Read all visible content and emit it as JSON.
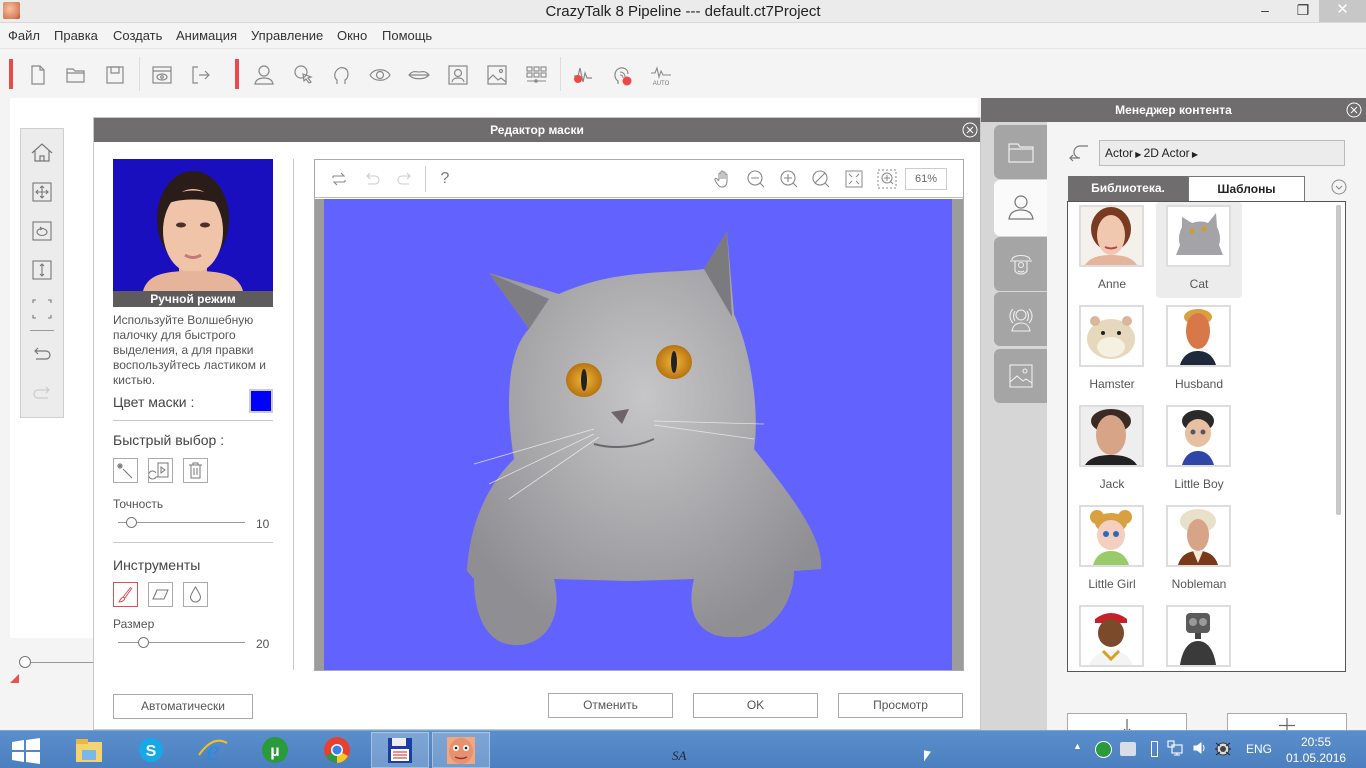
{
  "window": {
    "title": "CrazyTalk 8 Pipeline --- default.ct7Project",
    "controls": {
      "minimize": "–",
      "restore": "❐",
      "close": "✕"
    }
  },
  "menu": [
    "Файл",
    "Правка",
    "Создать",
    "Анимация",
    "Управление",
    "Окно",
    "Помощь"
  ],
  "toolbar": {
    "icons": [
      "new-file",
      "open-folder",
      "save",
      "preview",
      "export",
      "actor",
      "select-cursor",
      "head-outline",
      "eye",
      "mouth",
      "portrait",
      "image",
      "grid-settings",
      "voice-record",
      "face-audio",
      "auto-motion"
    ],
    "auto_label": "AUTO"
  },
  "left_tools": [
    "home",
    "move",
    "rotate",
    "scale-vertical",
    "fit-frame",
    "undo",
    "redo"
  ],
  "mask_editor": {
    "title": "Редактор маски",
    "mode_caption": "Ручной режим",
    "instructions": "Используйте Волшебную палочку для быстрого выделения, а для правки воспользуйтесь ластиком и кистью.",
    "mask_color_label": "Цвет маски :",
    "mask_color": "#0000ff",
    "quick_select_label": "Быстрый выбор :",
    "quick_select_buttons": [
      "magic-wand",
      "import-mask",
      "delete"
    ],
    "precision_label": "Точность",
    "precision_value": "10",
    "precision_fraction": 0.1,
    "tools_label": "Инструменты",
    "tools": [
      "brush",
      "eraser",
      "drop"
    ],
    "active_tool": "brush",
    "size_label": "Размер",
    "size_value": "20",
    "size_fraction": 0.2,
    "auto_button": "Автоматически",
    "canvas_toolbar": {
      "left": [
        "reset",
        "undo",
        "redo",
        "help"
      ],
      "help_label": "?",
      "right": [
        "pan-hand",
        "zoom-out",
        "zoom-in",
        "zoom-reset",
        "fit-screen",
        "zoom-region"
      ],
      "zoom_level": "61%"
    },
    "canvas_background": "#6262fe",
    "buttons": {
      "cancel": "Отменить",
      "ok": "OK",
      "preview": "Просмотр"
    }
  },
  "content_manager": {
    "title": "Менеджер контента",
    "side_tabs": [
      "folder",
      "actor",
      "accessory",
      "voice",
      "background"
    ],
    "active_side_tab": "actor",
    "breadcrumb": [
      "Actor",
      "2D Actor"
    ],
    "tabs": {
      "library": "Библиотека.",
      "templates": "Шаблоны"
    },
    "items": [
      {
        "label": "Anne",
        "selected": false
      },
      {
        "label": "Cat",
        "selected": true
      },
      {
        "label": "Hamster",
        "selected": false
      },
      {
        "label": "Husband",
        "selected": false
      },
      {
        "label": "Jack",
        "selected": false
      },
      {
        "label": "Little Boy",
        "selected": false
      },
      {
        "label": "Little Girl",
        "selected": false
      },
      {
        "label": "Nobleman",
        "selected": false
      },
      {
        "label": "",
        "selected": false
      },
      {
        "label": "",
        "selected": false
      }
    ],
    "bottom_buttons": [
      "download",
      "add"
    ]
  },
  "taskbar": {
    "apps": [
      "windows-start",
      "file-explorer",
      "skype",
      "internet-explorer",
      "utorrent",
      "chrome",
      "editor-floppy",
      "crazytalk"
    ],
    "center_text": "SA",
    "tray": {
      "language": "ENG",
      "time": "20:55",
      "date": "01.05.2016"
    }
  }
}
